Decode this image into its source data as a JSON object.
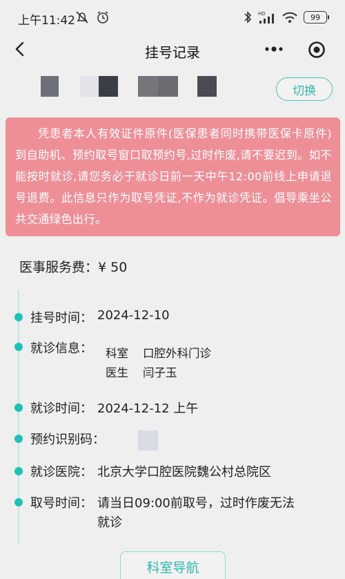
{
  "status_bar": {
    "time": "上午11:42",
    "battery": "99"
  },
  "nav": {
    "title": "挂号记录"
  },
  "patient": {
    "switch_label": "切换"
  },
  "notice": {
    "text": "凭患者本人有效证件原件(医保患者同时携带医保卡原件)到自助机、预约取号窗口取预约号,过时作废,请不要迟到。如不能按时就诊,请您务必于就诊日前一天中午12:00前线上申请退号退费。此信息只作为取号凭证,不作为就诊凭证。倡导乘坐公共交通绿色出行。"
  },
  "fee": {
    "label": "医事服务费：",
    "value": "¥ 50"
  },
  "details": {
    "reg_time_label": "挂号时间：",
    "reg_time_value": "2024-12-10",
    "visit_info_label": "就诊信息：",
    "dept_label": "科室",
    "dept_value": "口腔外科门诊",
    "doctor_label": "医生",
    "doctor_value": "闫子玉",
    "visit_time_label": "就诊时间：",
    "visit_time_value": "2024-12-12 上午",
    "code_label": "预约识别码：",
    "hospital_label": "就诊医院：",
    "hospital_value": "北京大学口腔医院魏公村总院区",
    "pickup_label": "取号时间：",
    "pickup_value_line1": "请当日09:00前取号，过时作废无法",
    "pickup_value_line2": "就诊"
  },
  "buttons": {
    "dept_nav": "科室导航"
  },
  "colors": {
    "accent": "#1fc0b6",
    "notice_bg": "#ee8f97",
    "background": "#efefef"
  },
  "icons": {
    "back": "back-arrow-icon",
    "more": "more-dots-icon",
    "target": "target-icon"
  }
}
